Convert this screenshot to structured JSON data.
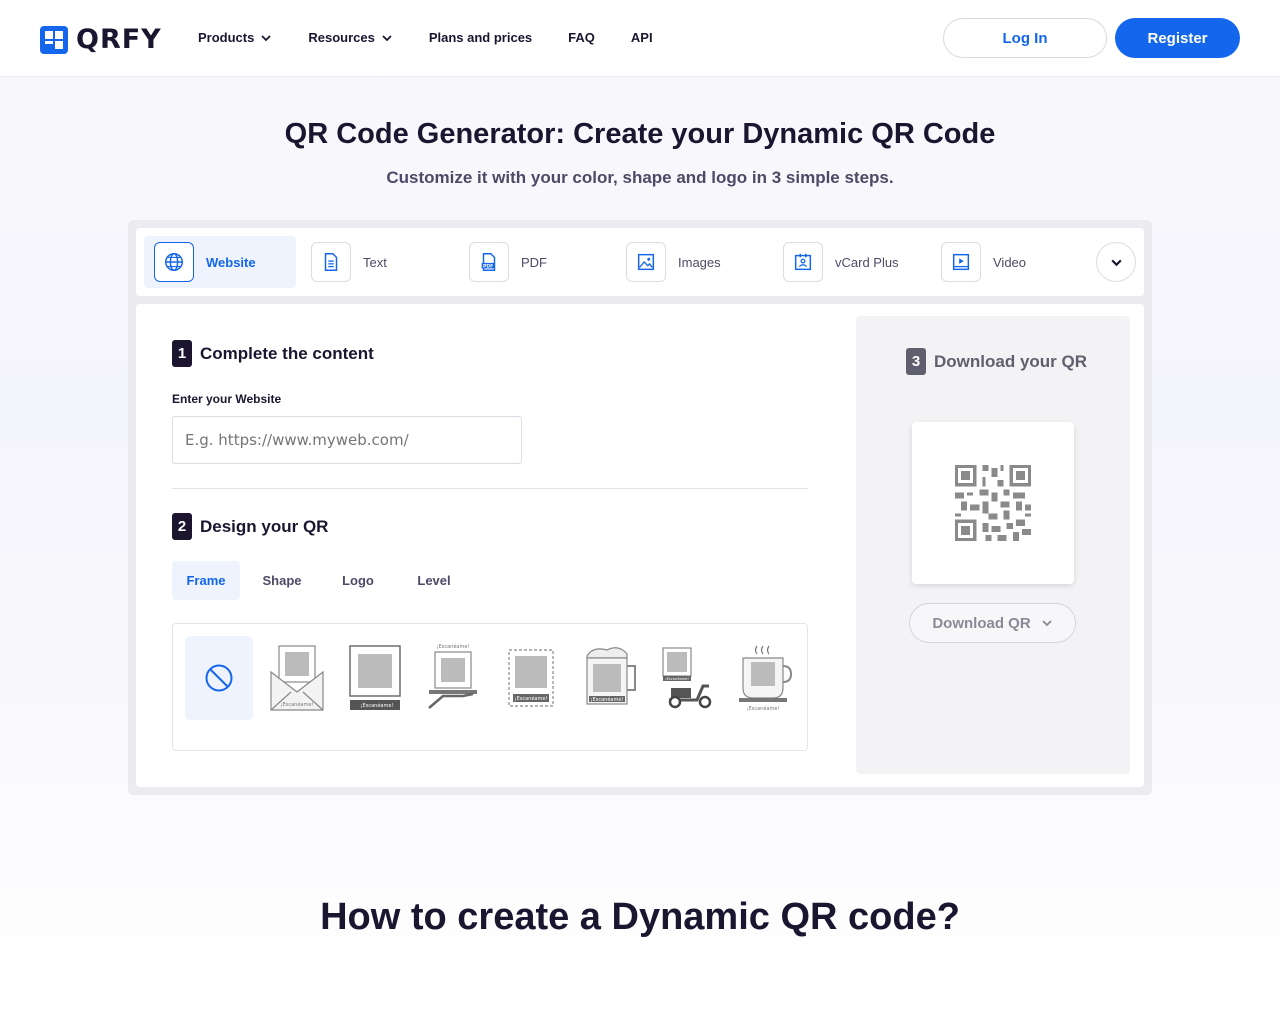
{
  "header": {
    "brand": "QRFY",
    "nav": [
      {
        "label": "Products",
        "has_dropdown": true
      },
      {
        "label": "Resources",
        "has_dropdown": true
      },
      {
        "label": "Plans and prices",
        "has_dropdown": false
      },
      {
        "label": "FAQ",
        "has_dropdown": false
      },
      {
        "label": "API",
        "has_dropdown": false
      }
    ],
    "login": "Log In",
    "register": "Register"
  },
  "hero": {
    "title": "QR Code Generator: Create your Dynamic QR Code",
    "subtitle": "Customize it with your color, shape and logo in 3 simple steps."
  },
  "type_tabs": [
    {
      "label": "Website",
      "icon": "globe-icon",
      "active": true
    },
    {
      "label": "Text",
      "icon": "document-icon",
      "active": false
    },
    {
      "label": "PDF",
      "icon": "pdf-icon",
      "active": false
    },
    {
      "label": "Images",
      "icon": "image-icon",
      "active": false
    },
    {
      "label": "vCard Plus",
      "icon": "contact-card-icon",
      "active": false
    },
    {
      "label": "Video",
      "icon": "video-icon",
      "active": false
    }
  ],
  "step1": {
    "number": "1",
    "title": "Complete the content",
    "field_label": "Enter your Website",
    "placeholder": "E.g. https://www.myweb.com/"
  },
  "step2": {
    "number": "2",
    "title": "Design your QR",
    "tabs": [
      "Frame",
      "Shape",
      "Logo",
      "Level"
    ],
    "active_tab": "Frame",
    "frames": [
      {
        "name": "frame-none",
        "label": ""
      },
      {
        "name": "frame-envelope",
        "label": "¡Escanéame!"
      },
      {
        "name": "frame-screen",
        "label": "¡Escanéame!"
      },
      {
        "name": "frame-hand",
        "label": "¡Escanéame!"
      },
      {
        "name": "frame-stamp",
        "label": "¡Escanéame!"
      },
      {
        "name": "frame-beer",
        "label": "¡Escanéame!"
      },
      {
        "name": "frame-scooter",
        "label": "¡Escanéame!"
      },
      {
        "name": "frame-cup",
        "label": "¡Escanéame!"
      }
    ]
  },
  "step3": {
    "number": "3",
    "title": "Download your QR",
    "button": "Download QR"
  },
  "section": {
    "how_title": "How to create a Dynamic QR code?"
  },
  "colors": {
    "brand_blue": "#1466ec",
    "text_dark": "#1b1530",
    "active_bg": "#eef3fd"
  }
}
